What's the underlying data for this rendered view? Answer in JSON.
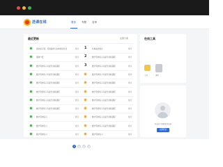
{
  "app": {
    "logo_text": "选课在线"
  },
  "nav": {
    "items": [
      {
        "label": "首页",
        "active": true
      },
      {
        "label": "专题",
        "active": false
      },
      {
        "label": "名师",
        "active": false
      }
    ]
  },
  "main": {
    "title": "最近更新",
    "filter": "全部分类",
    "rows": [
      {
        "left_text": "语文复习课：词语运用与文本阅读方法",
        "left_tag": "推荐",
        "right_num": "1",
        "right_text": "时事政治要点",
        "right_tag": "推荐"
      },
      {
        "left_text": "课题介绍",
        "left_tag": "推荐",
        "right_num": "2",
        "right_text": "数学同步练习与提升训练课程",
        "right_tag": "推荐"
      },
      {
        "left_text": "数学同步练习与提升训练课程",
        "left_tag": "推荐",
        "right_num": "3",
        "right_text": "数学同步练习与提升训练课程",
        "right_tag": "推荐"
      },
      {
        "left_text": "数学同步练习与提升训练课程",
        "left_tag": "推荐",
        "right_num": "",
        "right_text": "数学同步练习与提升训练课程",
        "right_tag": "推荐"
      },
      {
        "left_text": "数学同步练习与提升训练课程",
        "left_tag": "推荐",
        "right_num": "",
        "right_text": "数学同步练习与提升训练课程",
        "right_tag": "推荐"
      },
      {
        "left_text": "数学同步练习与提升训练课程",
        "left_tag": "推荐",
        "right_num": "",
        "right_text": "数学同步练习与提升训练课程",
        "right_tag": "推荐"
      },
      {
        "left_text": "数学同步练习与提升训练课程",
        "left_tag": "推荐",
        "right_num": "",
        "right_text": "数学同步练习与提升训练课程",
        "right_tag": "推荐"
      },
      {
        "left_text": "数学同步练习与提升训练课程",
        "left_tag": "推荐",
        "right_num": "",
        "right_text": "数学同步练习与提升训练课程",
        "right_tag": "推荐"
      },
      {
        "left_text": "数学同步练习",
        "left_tag": "推荐",
        "right_num": "",
        "right_text": "数学同步练习与提升训练课程",
        "right_tag": "推荐"
      },
      {
        "left_text": "数学同步练习",
        "left_tag": "推荐",
        "right_num": "",
        "right_text": "数学同步练习与提升训练课程",
        "right_tag": "推荐"
      },
      {
        "left_text": "数学同步练习",
        "left_tag": "推荐",
        "right_num": "",
        "right_text": "数学同步练习",
        "right_tag": "推荐"
      }
    ],
    "pagination": [
      "1",
      "2",
      "3",
      "4"
    ],
    "current_page": "1"
  },
  "side": {
    "title": "在线工具",
    "tool1": "工具",
    "tool2": "课程",
    "note": "登录后可查看更多功能",
    "button_label": "立即登录"
  },
  "colors": {
    "accent": "#2b6cd8",
    "green": "#3ab54a",
    "orange": "#f0a53a"
  }
}
